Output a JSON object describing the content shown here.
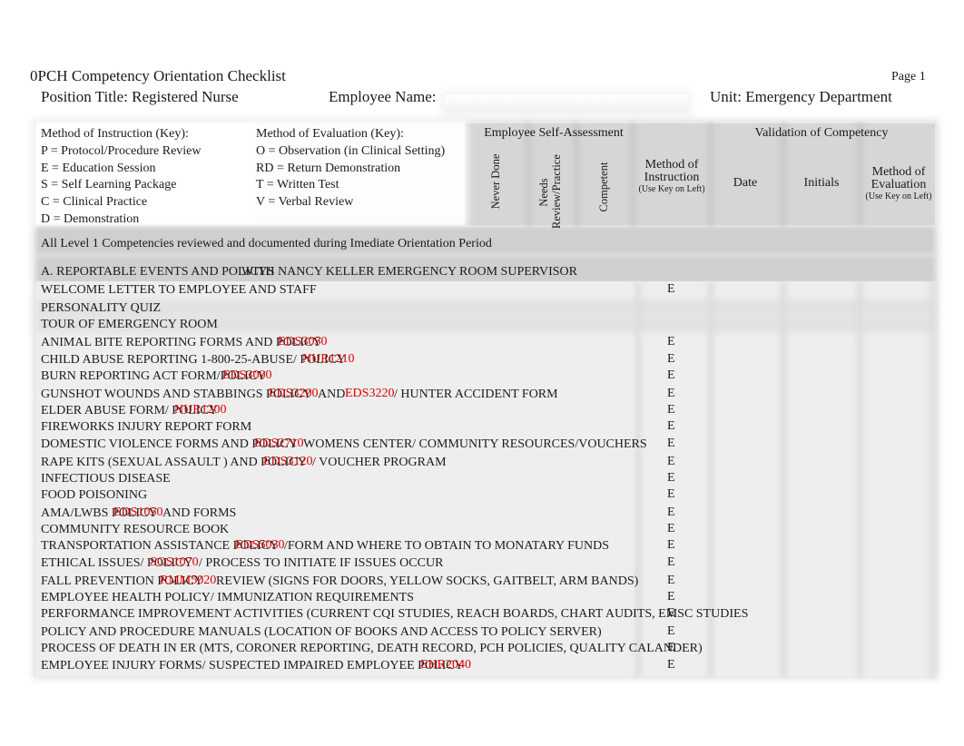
{
  "document": {
    "title": "0PCH Competency Orientation Checklist",
    "page_label": "Page 1",
    "position_title": "Position Title: Registered Nurse",
    "employee_name_label": "Employee Name:",
    "employee_name_value": "",
    "unit": "Unit:  Emergency Department"
  },
  "keys": {
    "instruction": {
      "heading": "Method of Instruction (Key):",
      "items": [
        "P = Protocol/Procedure Review",
        "E = Education Session",
        "S = Self Learning Package",
        "C = Clinical Practice",
        "D = Demonstration"
      ]
    },
    "evaluation": {
      "heading": "Method of Evaluation (Key):",
      "items": [
        "O = Observation (in Clinical Setting)",
        "RD = Return Demonstration",
        "T = Written Test",
        "V = Verbal Review"
      ]
    }
  },
  "columns": {
    "self_assessment_group": "Employee Self-Assessment",
    "never_done": "Never Done",
    "needs_review_1": "Needs",
    "needs_review_2": "Review/Practice",
    "competent": "Competent",
    "method_instruction_1": "Method of",
    "method_instruction_2": "Instruction",
    "method_instruction_note": "(Use Key on Left)",
    "validation_group": "Validation of Competency",
    "date": "Date",
    "initials": "Initials",
    "method_evaluation_1": "Method of",
    "method_evaluation_2": "Evaluation",
    "method_evaluation_note": "(Use Key on Left)"
  },
  "note": "All Level 1 Competencies reviewed and documented during Imediate Orientation Period",
  "section_title": "A. REPORTABLE EVENTS AND POLICYS",
  "section_overlay": "WITH NANCY KELLER EMERGENCY ROOM SUPERVISOR",
  "items": [
    {
      "text": "WELCOME LETTER TO EMPLOYEE AND STAFF",
      "method": "E"
    },
    {
      "text": "PERSONALITY QUIZ",
      "method": ""
    },
    {
      "text": "TOUR OF EMERGENCY ROOM",
      "method": ""
    },
    {
      "text": "ANIMAL BITE REPORTING FORMS AND POLICY",
      "method": "E",
      "codes": [
        "EDS3050"
      ]
    },
    {
      "text": "CHILD ABUSE REPORTING 1-800-25-ABUSE/ POLICY",
      "method": "E",
      "codes": [
        "NUR1210"
      ]
    },
    {
      "text": "BURN REPORTING ACT FORM/POLICY",
      "method": "E",
      "codes": [
        "EDS3000"
      ]
    },
    {
      "text": "GUNSHOT WOUNDS AND STABBINGS POLICY",
      "method": "E",
      "codes": [
        "EDS3200"
      ],
      "mid": "AND",
      "codes2": [
        "EDS3220"
      ],
      "tail": "/ HUNTER ACCIDENT FORM"
    },
    {
      "text": "ELDER ABUSE FORM/ POLICY",
      "method": "E",
      "codes": [
        "NUR1200"
      ]
    },
    {
      "text": "FIREWORKS INJURY REPORT FORM",
      "method": "E"
    },
    {
      "text": "DOMESTIC VIOLENCE FORMS AND POLICY",
      "method": "E",
      "codes": [
        "EDS2710"
      ],
      "tail": "WOMENS CENTER/ COMMUNITY RESOURCES/VOUCHERS"
    },
    {
      "text": "RAPE KITS (SEXUAL ASSAULT ) AND POLICY",
      "method": "E",
      "codes": [
        "EDS3120"
      ],
      "tail": "/ VOUCHER PROGRAM"
    },
    {
      "text": "INFECTIOUS DISEASE",
      "method": "E"
    },
    {
      "text": "FOOD POISONING",
      "method": "E"
    },
    {
      "text": "AMA/LWBS POLICY",
      "method": "E",
      "codes": [
        "EDS1050"
      ],
      "tail": "AND FORMS"
    },
    {
      "text": "COMMUNITY RESOURCE BOOK",
      "method": "E"
    },
    {
      "text": "TRANSPORTATION ASSISTANCE POLICY",
      "method": "E",
      "codes": [
        "EDS5030"
      ],
      "tail": "/FORM AND WHERE TO OBTAIN TO MONATARY FUNDS"
    },
    {
      "text": "ETHICAL ISSUES/ POLICY",
      "method": "E",
      "codes": [
        "SOS1070"
      ],
      "tail": "/ PROCESS TO INITIATE IF ISSUES OCCUR"
    },
    {
      "text": "FALL PREVENTION POLICY",
      "method": "E",
      "codes": [
        "RMM5020"
      ],
      "tail": "REVIEW (SIGNS FOR DOORS, YELLOW SOCKS, GAITBELT, ARM BANDS)"
    },
    {
      "text": "EMPLOYEE HEALTH POLICY/ IMMUNIZATION REQUIREMENTS",
      "method": "E"
    },
    {
      "text": "PERFORMANCE IMPROVEMENT ACTIVITIES (CURRENT CQI STUDIES, REACH BOARDS, CHART AUDITS, EMSC STUDIES",
      "method": "E"
    },
    {
      "text": "POLICY AND PROCEDURE MANUALS (LOCATION OF BOOKS AND ACCESS TO POLICY SERVER)",
      "method": "E"
    },
    {
      "text": "PROCESS OF DEATH IN ER (MTS, CORONER REPORTING, DEATH RECORD, PCH POLICIES, QUALITY CALANDER)",
      "method": "E"
    },
    {
      "text": "EMPLOYEE INJURY FORMS/ SUSPECTED IMPAIRED EMPLOYEE POLICY",
      "method": "E",
      "codes": [
        "EHR2040"
      ]
    }
  ],
  "colors": {
    "policy_code": "#e00000",
    "header_gray": "#d6d6d6"
  }
}
